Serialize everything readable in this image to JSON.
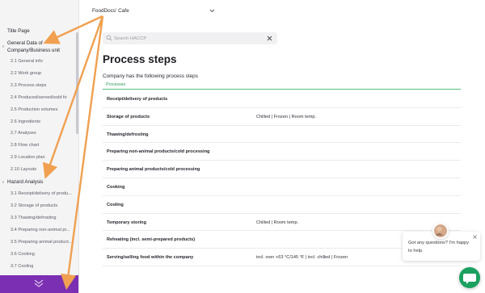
{
  "colors": {
    "accent_green": "#2e9a58",
    "sidebar_bottom_purple": "#7b2fb2",
    "chat_green": "#1aa05f",
    "annotation_orange": "#f0a050"
  },
  "sidebar": {
    "title_page": "Title Page",
    "general_data": "General Data of Company/Business unit",
    "general_items": [
      "2.1 General info",
      "2.2 Work group",
      "2.3 Process steps",
      "2.4 Produced/served/sold fo",
      "2.5 Production volumes",
      "2.6 Ingredients",
      "2.7 Analyses",
      "2.8 Flow chart",
      "2.9 Location plan",
      "2.10 Layouts"
    ],
    "hazard_analysis": "Hazard Analysis",
    "hazard_items": [
      "3.1 Receipt/delivery of produ...",
      "3.2 Storage of products",
      "3.3 Thawing/defrosting",
      "3.4 Preparing non-animal pr...",
      "3.5 Preparing animal product...",
      "3.6 Cooking",
      "3.7 Cooling"
    ],
    "collapse_icon": "double-chevron-down-icon"
  },
  "header": {
    "workspace": "FoodDocs' Cafe",
    "chevron_icon": "chevron-down-icon"
  },
  "search": {
    "placeholder": "Search HACCP",
    "icon": "search-icon",
    "clear_icon": "close-icon"
  },
  "main": {
    "title": "Process steps",
    "intro": "Company has the following process steps",
    "tab": "Processes",
    "rows": [
      {
        "process": "Receipt/delivery of products",
        "storage": ""
      },
      {
        "process": "Storage of products",
        "storage": "Chilled | Frozen | Room temp."
      },
      {
        "process": "Thawing/defrosting",
        "storage": ""
      },
      {
        "process": "Preparing non-animal products/cold processing",
        "storage": ""
      },
      {
        "process": "Preparing animal products/cold processing",
        "storage": ""
      },
      {
        "process": "Cooking",
        "storage": ""
      },
      {
        "process": "Cooling",
        "storage": ""
      },
      {
        "process": "Temporary storing",
        "storage": "Chilled | Room temp."
      },
      {
        "process": "Reheating (incl. semi-prepared products)",
        "storage": ""
      },
      {
        "process": "Serving/selling food within the company",
        "storage": "incl. over +63 °C/145 °F | incl. chilled | Frozen"
      }
    ]
  },
  "chat": {
    "message": "Got any questions? I'm happy to help.",
    "close_icon": "close-icon",
    "launcher_icon": "chat-bubble-icon"
  }
}
